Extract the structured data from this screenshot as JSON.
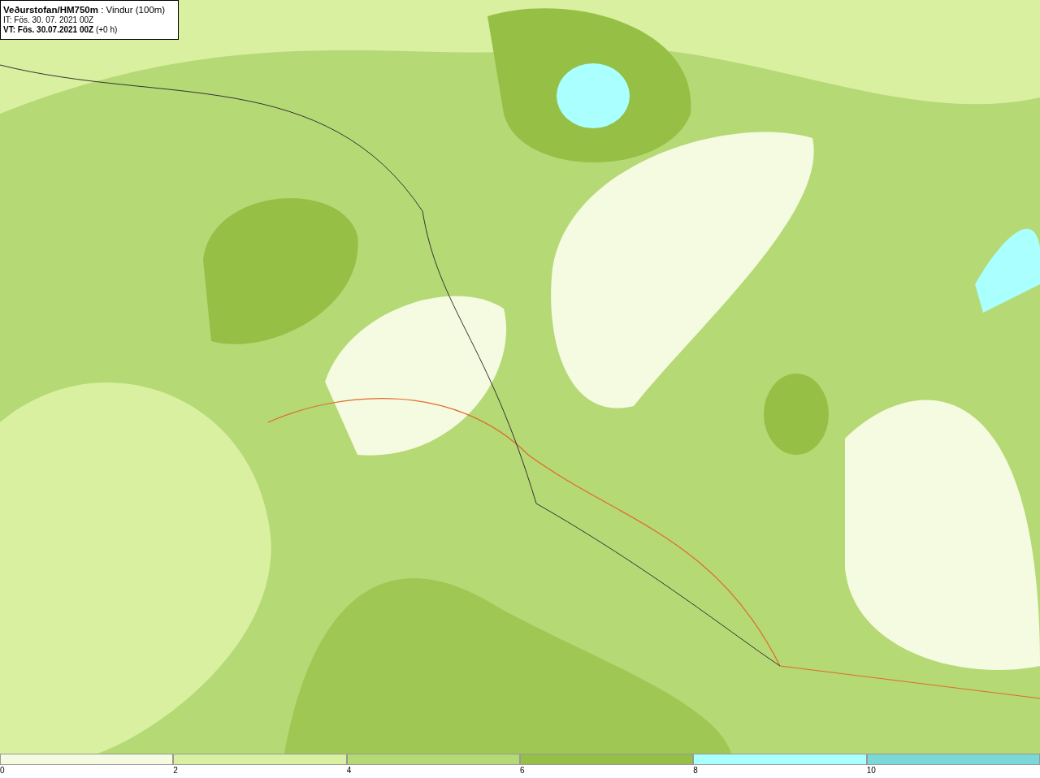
{
  "header": {
    "lines": [
      "**Veðurstofan/HM750m** : Vindur (100m)",
      "IT: Fös. 30. 07. 2021 00Z",
      "**VT: Fös. 30.07.2021 00Z** (+0 h)"
    ]
  },
  "legend": {
    "bins": [
      {
        "color": "#f5fbe0",
        "label": "0"
      },
      {
        "color": "#d9f0a0",
        "label": "2"
      },
      {
        "color": "#b5d975",
        "label": "4"
      },
      {
        "color": "#95bf45",
        "label": "6"
      },
      {
        "color": "#aaffff",
        "label": "8"
      },
      {
        "color": "#7ad8d8",
        "label": "10"
      }
    ]
  }
}
